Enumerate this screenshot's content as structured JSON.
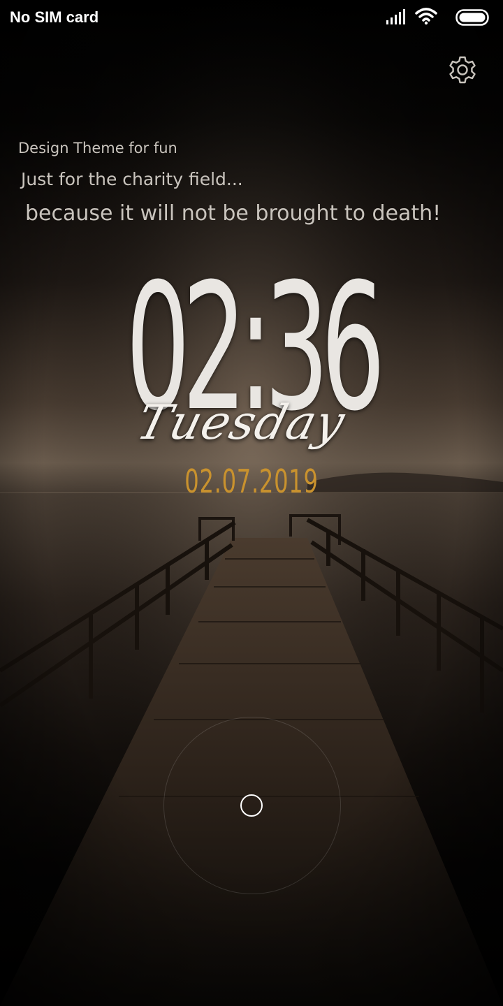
{
  "status_bar": {
    "carrier": "No SIM card",
    "icons": [
      "cellular-signal-icon",
      "wifi-icon",
      "battery-icon"
    ]
  },
  "lock_screen": {
    "settings_icon": "gear-icon",
    "messages": [
      "Design Theme for fun",
      "Just for the charity field...",
      "because it will not be brought to death!"
    ],
    "time": "02:36",
    "weekday": "Tuesday",
    "date": "02.07.2019",
    "unlock_icon": "unlock-circle-icon"
  },
  "colors": {
    "date_accent": "#c9922e",
    "text_light": "#e9e6e2",
    "message_text": "#c9c4bd"
  }
}
